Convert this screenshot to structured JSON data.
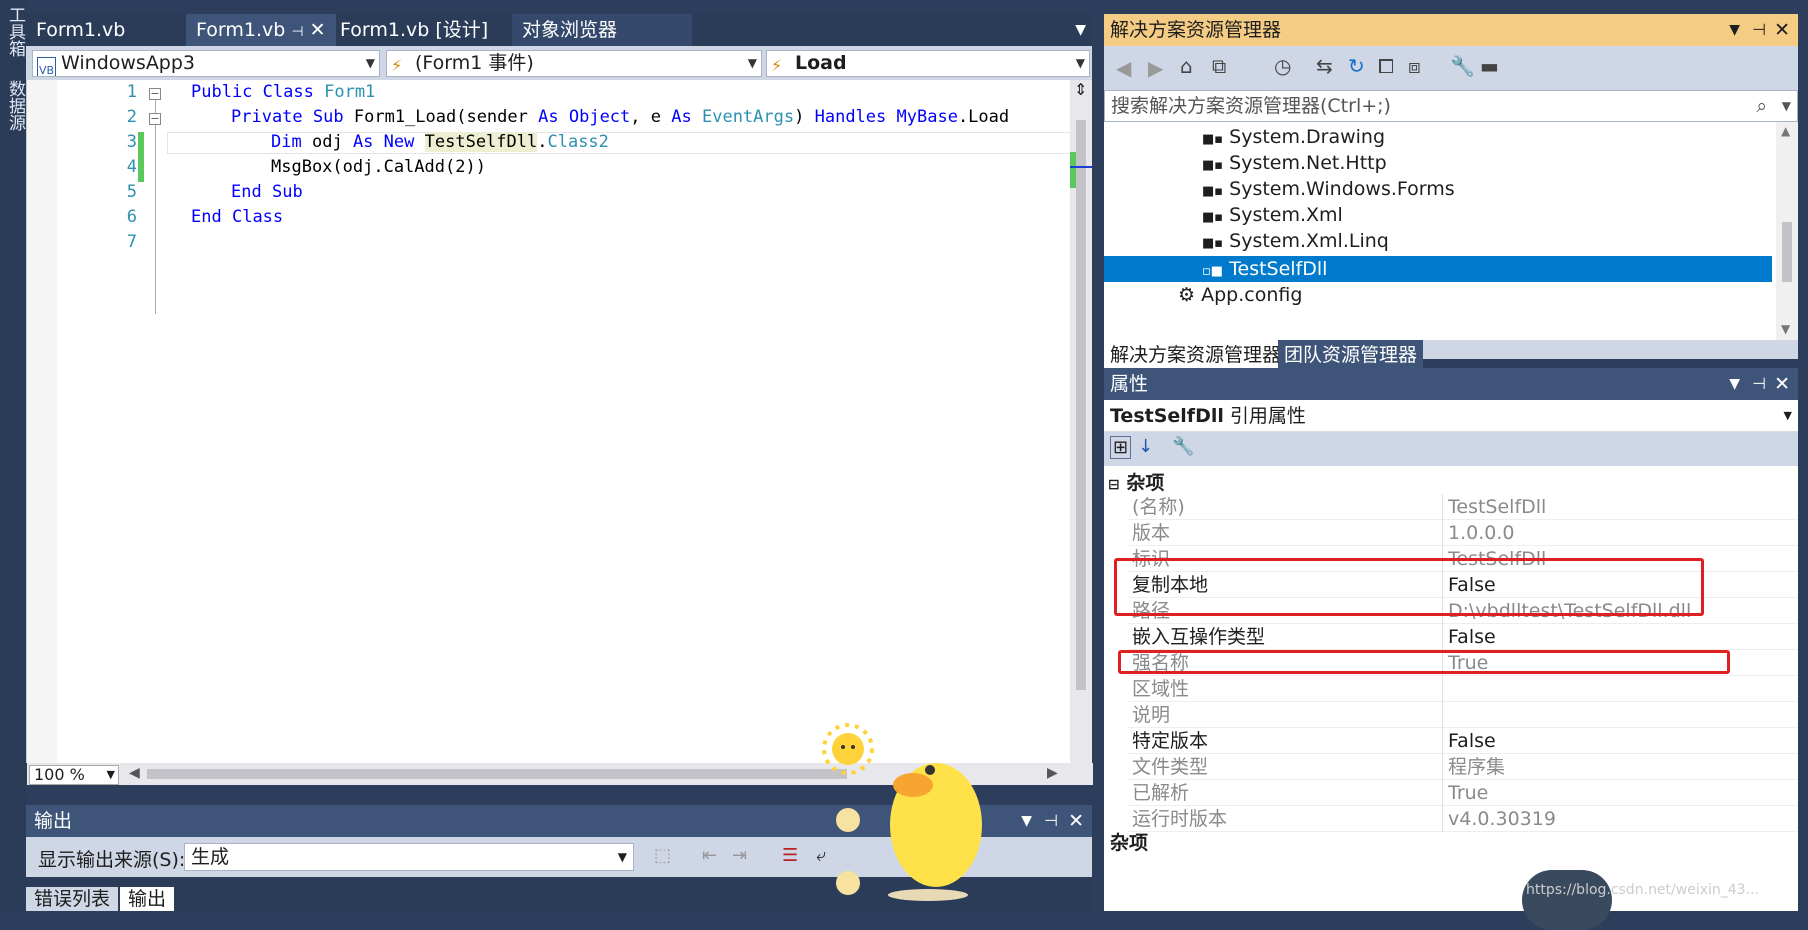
{
  "left_strip": {
    "toolbox": "工具箱",
    "datasource": "数据源"
  },
  "tabs": [
    {
      "label": "Form1.vb"
    },
    {
      "label": "Form1.vb"
    },
    {
      "label": "Form1.vb [设计]"
    },
    {
      "label": "对象浏览器"
    }
  ],
  "nav": {
    "project": "WindowsApp3",
    "events": "(Form1 事件)",
    "method": "Load"
  },
  "code": {
    "line_numbers": [
      "1",
      "2",
      "3",
      "4",
      "5",
      "6",
      "7"
    ],
    "l1_kw1": "Public",
    "l1_kw2": "Class",
    "l1_name": "Form1",
    "l2_kw1": "Private",
    "l2_kw2": "Sub",
    "l2_name": "Form1_Load(sender",
    "l2_as1": "As",
    "l2_obj": "Object",
    "l2_e": ", e",
    "l2_as2": "As",
    "l2_args": "EventArgs",
    "l2_close": ")",
    "l2_handles": "Handles",
    "l2_mybase": "MyBase",
    "l2_load": ".Load",
    "l3_dim": "Dim",
    "l3_var": "odj",
    "l3_as": "As",
    "l3_new": "New",
    "l3_type": "TestSelfDll",
    "l3_dot": ".",
    "l3_class": "Class2",
    "l4": "MsgBox(odj.CalAdd(2))",
    "l5_end": "End",
    "l5_sub": "Sub",
    "l6_end": "End",
    "l6_class": "Class"
  },
  "zoom": "100 %",
  "output": {
    "title": "输出",
    "source_label": "显示输出来源(S):",
    "source_value": "生成",
    "bottom_tabs": [
      "错误列表",
      "输出"
    ]
  },
  "solution_explorer": {
    "title": "解决方案资源管理器",
    "search_placeholder": "搜索解决方案资源管理器(Ctrl+;)",
    "items": [
      {
        "label": "System.Drawing"
      },
      {
        "label": "System.Net.Http"
      },
      {
        "label": "System.Windows.Forms"
      },
      {
        "label": "System.Xml"
      },
      {
        "label": "System.Xml.Linq"
      },
      {
        "label": "TestSelfDll",
        "selected": true
      },
      {
        "label": "App.config"
      }
    ],
    "tabs": [
      "解决方案资源管理器",
      "团队资源管理器"
    ]
  },
  "properties": {
    "title": "属性",
    "object_name": "TestSelfDll",
    "object_kind": "引用属性",
    "category": "杂项",
    "rows": [
      {
        "name": "(名称)",
        "value": "TestSelfDll",
        "gray": true
      },
      {
        "name": "版本",
        "value": "1.0.0.0",
        "gray": true
      },
      {
        "name": "标识",
        "value": "TestSelfDll",
        "gray": true
      },
      {
        "name": "复制本地",
        "value": "False",
        "gray": false
      },
      {
        "name": "路径",
        "value": "D:\\vbdlltest\\TestSelfDll.dll",
        "gray": true
      },
      {
        "name": "嵌入互操作类型",
        "value": "False",
        "gray": false
      },
      {
        "name": "强名称",
        "value": "True",
        "gray": true
      },
      {
        "name": "区域性",
        "value": "",
        "gray": true
      },
      {
        "name": "说明",
        "value": "",
        "gray": true
      },
      {
        "name": "特定版本",
        "value": "False",
        "gray": false
      },
      {
        "name": "文件类型",
        "value": "程序集",
        "gray": true
      },
      {
        "name": "已解析",
        "value": "True",
        "gray": true
      },
      {
        "name": "运行时版本",
        "value": "v4.0.30319",
        "gray": true
      }
    ],
    "description_title": "杂项"
  },
  "watermark": "https://blog.csdn.net/weixin_43..."
}
